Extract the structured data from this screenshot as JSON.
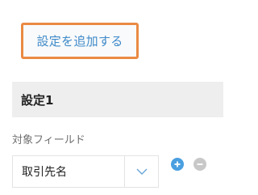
{
  "add_setting_button": {
    "label": "設定を追加する",
    "border_color": "#ea8a43",
    "text_color": "#3f8ac9"
  },
  "setting": {
    "title": "設定1",
    "field_label": "対象フィールド",
    "selected_field": "取引先名",
    "dropdown_icon": "chevron-down-icon",
    "add_icon": "plus-icon",
    "remove_icon": "minus-icon",
    "add_icon_color": "#4a9fe0",
    "remove_icon_color": "#c8c8c8"
  }
}
